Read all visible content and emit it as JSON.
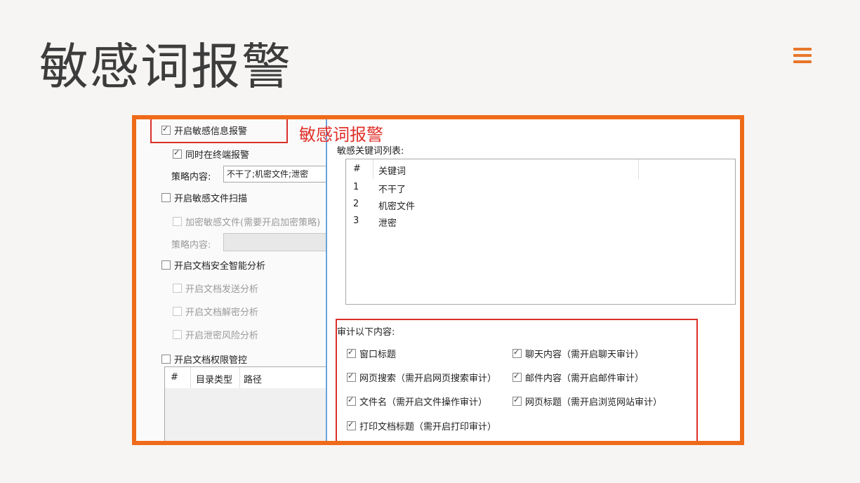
{
  "page": {
    "title": "敏感词报警"
  },
  "colors": {
    "accent": "#e8762a",
    "frame": "#ef6b1a",
    "highlight_red": "#d9302a"
  },
  "left_panel": {
    "enable_sensitive_alert": "开启敏感信息报警",
    "alert_on_terminal": "同时在终端报警",
    "policy_label": "策略内容:",
    "policy_value": "不干了;机密文件;泄密",
    "enable_file_scan": "开启敏感文件扫描",
    "encrypt_sensitive": "加密敏感文件(需要开启加密策略)",
    "policy_label_2": "策略内容:",
    "enable_doc_analysis": "开启文档安全智能分析",
    "doc_send_analysis": "开启文档发送分析",
    "doc_decrypt_analysis": "开启文档解密分析",
    "leak_risk_analysis": "开启泄密风险分析",
    "enable_doc_permission": "开启文档权限管控",
    "dir_table": {
      "headers": [
        "#",
        "目录类型",
        "路径"
      ]
    }
  },
  "annotation": {
    "label": "敏感词报警"
  },
  "right_panel": {
    "keyword_list_label": "敏感关键词列表:",
    "keyword_table": {
      "headers": [
        "#",
        "关键词"
      ],
      "rows": [
        {
          "num": "1",
          "word": "不干了"
        },
        {
          "num": "2",
          "word": "机密文件"
        },
        {
          "num": "3",
          "word": "泄密"
        }
      ]
    },
    "audit_label": "审计以下内容:",
    "audit_items": [
      "窗口标题",
      "聊天内容（需开启聊天审计）",
      "网页搜索（需开启网页搜索审计）",
      "邮件内容（需开启邮件审计）",
      "文件名（需开启文件操作审计）",
      "网页标题（需开启浏览网站审计）",
      "打印文档标题（需开启打印审计）"
    ]
  }
}
